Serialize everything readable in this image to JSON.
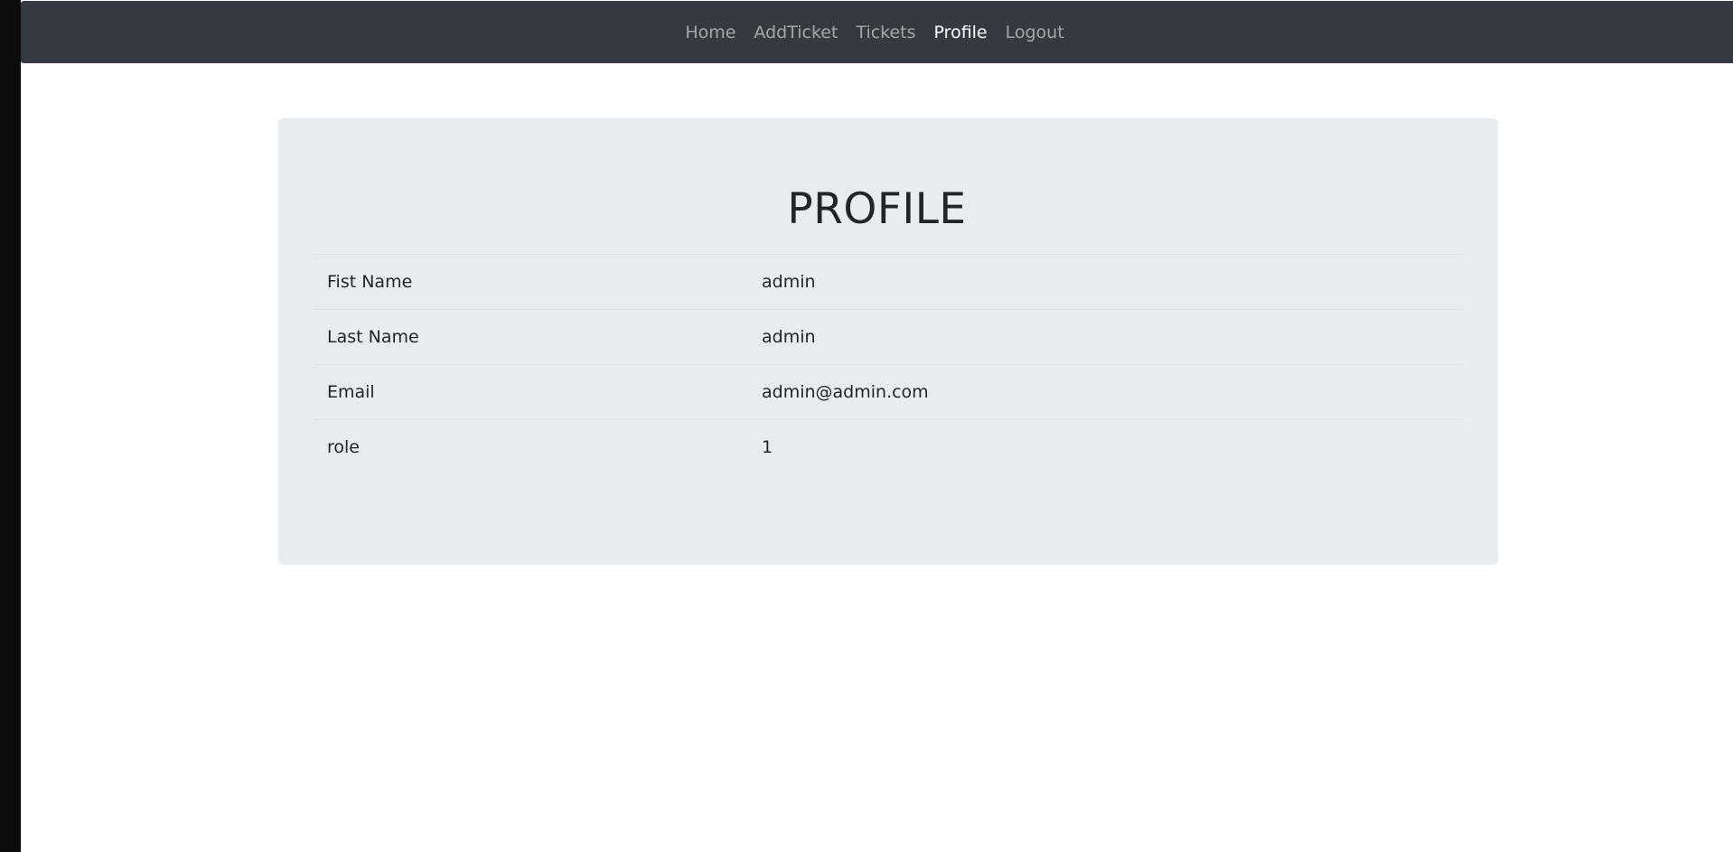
{
  "nav": {
    "items": [
      {
        "label": "Home",
        "active": false
      },
      {
        "label": "AddTicket",
        "active": false
      },
      {
        "label": "Tickets",
        "active": false
      },
      {
        "label": "Profile",
        "active": true
      },
      {
        "label": "Logout",
        "active": false
      }
    ]
  },
  "profile": {
    "title": "PROFILE",
    "rows": [
      {
        "label": "Fist Name",
        "value": "admin"
      },
      {
        "label": "Last Name",
        "value": "admin"
      },
      {
        "label": "Email",
        "value": "admin@admin.com"
      },
      {
        "label": "role",
        "value": "1"
      }
    ]
  },
  "colors": {
    "navbar_bg": "#343a40",
    "jumbotron_bg": "#e9ecef",
    "text": "#212529"
  }
}
